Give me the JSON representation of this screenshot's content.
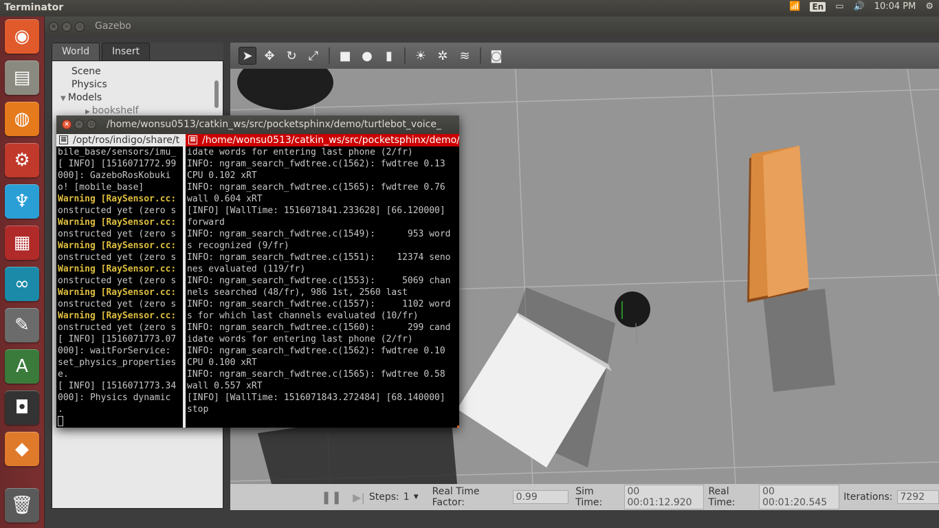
{
  "topbar": {
    "app_title": "Terminator",
    "keyboard": "En",
    "time": "10:04 PM",
    "icons": [
      "wifi-icon",
      "keyboard-icon",
      "battery-icon",
      "volume-icon",
      "gear-icon"
    ]
  },
  "launcher": {
    "items": [
      {
        "name": "ubuntu-dash",
        "glyph": "◉",
        "color": "#e05a2b"
      },
      {
        "name": "files",
        "glyph": "▤",
        "color": "#8a8a80"
      },
      {
        "name": "firefox",
        "glyph": "◍",
        "color": "#e57a1c"
      },
      {
        "name": "system-settings",
        "glyph": "⚙",
        "color": "#c0392b"
      },
      {
        "name": "gecko",
        "glyph": "♆",
        "color": "#2a9fd6"
      },
      {
        "name": "terminator",
        "glyph": "▦",
        "color": "#b02a2a"
      },
      {
        "name": "arduino",
        "glyph": "∞",
        "color": "#1a8aa8"
      },
      {
        "name": "text-editor",
        "glyph": "✎",
        "color": "#6b6b6b"
      },
      {
        "name": "software-updater",
        "glyph": "A",
        "color": "#3a7a3a"
      },
      {
        "name": "disk",
        "glyph": "◘",
        "color": "#333333"
      },
      {
        "name": "sublime",
        "glyph": "◆",
        "color": "#e07a2b"
      },
      {
        "name": "trash",
        "glyph": "🗑",
        "color": "#5a5a5a"
      }
    ]
  },
  "gazebo": {
    "title": "Gazebo",
    "tabs": {
      "world": "World",
      "insert": "Insert"
    },
    "tree": [
      "Scene",
      "Physics",
      "Models"
    ],
    "tree_child": "bookshelf",
    "bottom": {
      "steps_label": "Steps:",
      "steps_value": "1",
      "rtf_label": "Real Time Factor:",
      "rtf_value": "0.99",
      "sim_label": "Sim Time:",
      "sim_value": "00 00:01:12.920",
      "real_label": "Real Time:",
      "real_value": "00 00:01:20.545",
      "iter_label": "Iterations:",
      "iter_value": "7292"
    }
  },
  "terminal": {
    "title": "/home/wonsu0513/catkin_ws/src/pocketsphinx/demo/turtlebot_voice_",
    "left_title": "/opt/ros/indigo/share/t",
    "right_title": "/home/wonsu0513/catkin_ws/src/pocketsphinx/demo/",
    "left_lines": [
      {
        "t": "bile_base/sensors/imu_",
        "w": false
      },
      {
        "t": "[ INFO] [1516071772.99",
        "w": false
      },
      {
        "t": "000]: GazeboRosKobuki",
        "w": false
      },
      {
        "t": "o! [mobile_base]",
        "w": false
      },
      {
        "t": "Warning [RaySensor.cc:",
        "w": true
      },
      {
        "t": "onstructed yet (zero s",
        "w": false
      },
      {
        "t": "Warning [RaySensor.cc:",
        "w": true
      },
      {
        "t": "onstructed yet (zero s",
        "w": false
      },
      {
        "t": "Warning [RaySensor.cc:",
        "w": true
      },
      {
        "t": "onstructed yet (zero s",
        "w": false
      },
      {
        "t": "Warning [RaySensor.cc:",
        "w": true
      },
      {
        "t": "onstructed yet (zero s",
        "w": false
      },
      {
        "t": "Warning [RaySensor.cc:",
        "w": true
      },
      {
        "t": "onstructed yet (zero s",
        "w": false
      },
      {
        "t": "Warning [RaySensor.cc:",
        "w": true
      },
      {
        "t": "onstructed yet (zero s",
        "w": false
      },
      {
        "t": "[ INFO] [1516071773.07",
        "w": false
      },
      {
        "t": "000]: waitForService:",
        "w": false
      },
      {
        "t": "set_physics_properties",
        "w": false
      },
      {
        "t": "e.",
        "w": false
      },
      {
        "t": "[ INFO] [1516071773.34",
        "w": false
      },
      {
        "t": "000]: Physics dynamic",
        "w": false
      },
      {
        "t": ".",
        "w": false
      }
    ],
    "right_lines": [
      "idate words for entering last phone (2/fr)",
      "INFO: ngram_search_fwdtree.c(1562): fwdtree 0.13",
      "CPU 0.102 xRT",
      "INFO: ngram_search_fwdtree.c(1565): fwdtree 0.76",
      "wall 0.604 xRT",
      "[INFO] [WallTime: 1516071841.233628] [66.120000]",
      "forward",
      "INFO: ngram_search_fwdtree.c(1549):      953 word",
      "s recognized (9/fr)",
      "INFO: ngram_search_fwdtree.c(1551):    12374 seno",
      "nes evaluated (119/fr)",
      "INFO: ngram_search_fwdtree.c(1553):     5069 chan",
      "nels searched (48/fr), 986 1st, 2560 last",
      "INFO: ngram_search_fwdtree.c(1557):     1102 word",
      "s for which last channels evaluated (10/fr)",
      "INFO: ngram_search_fwdtree.c(1560):      299 cand",
      "idate words for entering last phone (2/fr)",
      "INFO: ngram_search_fwdtree.c(1562): fwdtree 0.10",
      "CPU 0.100 xRT",
      "INFO: ngram_search_fwdtree.c(1565): fwdtree 0.58",
      "wall 0.557 xRT",
      "[INFO] [WallTime: 1516071843.272484] [68.140000]",
      "stop"
    ]
  }
}
